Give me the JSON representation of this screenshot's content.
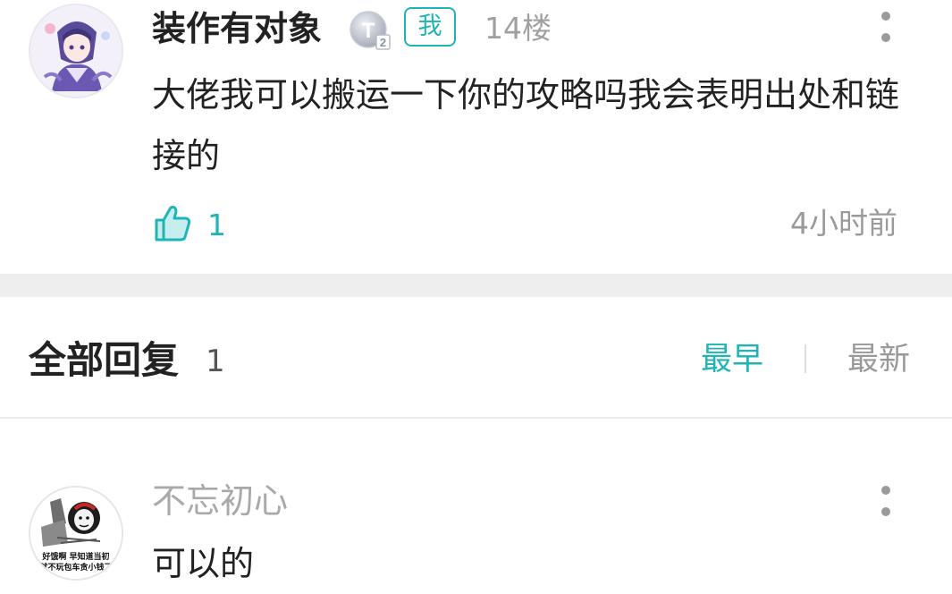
{
  "post": {
    "username": "装作有对象",
    "level_badge_label": "T",
    "level_badge_sub": "2",
    "me_tag": "我",
    "floor": "14楼",
    "content": "大佬我可以搬运一下你的攻略吗我会表明出处和链接的",
    "likes": "1",
    "time": "4小时前"
  },
  "replies_header": {
    "title": "全部回复",
    "count": "1",
    "sort_earliest": "最早",
    "sort_latest": "最新"
  },
  "reply": {
    "username": "不忘初心",
    "content": "可以的",
    "avatar_text_line1": "好饿啊 早知道当初",
    "avatar_text_line2": "就不玩包车贪小钱了"
  },
  "colors": {
    "accent": "#1fb5b7",
    "text_primary": "#222222",
    "text_secondary": "#9a9a9a",
    "separator": "#eeeeee"
  },
  "icons": {
    "like": "thumbs-up-icon",
    "more": "more-vertical-icon",
    "level": "level-badge-icon"
  }
}
